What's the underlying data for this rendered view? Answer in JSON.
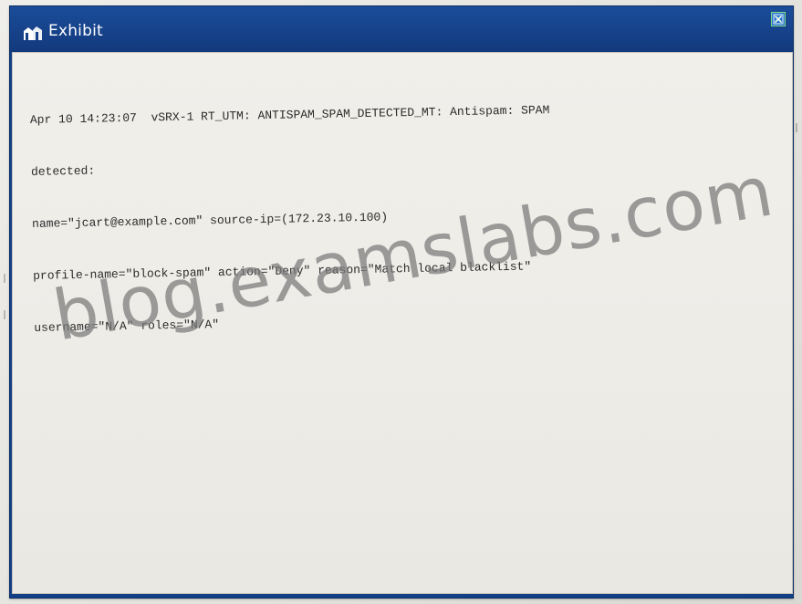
{
  "window": {
    "title": "Exhibit"
  },
  "log": {
    "lines": [
      "Apr 10 14:23:07  vSRX-1 RT_UTM: ANTISPAM_SPAM_DETECTED_MT: Antispam: SPAM",
      "detected:",
      "name=\"jcart@example.com\" source-ip=(172.23.10.100)",
      "profile-name=\"block-spam\" action=\"Deny\" reason=\"Match local blacklist\"",
      "username=\"N/A\" roles=\"N/A\""
    ]
  },
  "watermark": {
    "text": "blog.examslabs.com"
  },
  "colors": {
    "titlebar": "#153f86",
    "content_bg": "#eeece7",
    "close_border": "#7fdc7f"
  },
  "icons": {
    "title_icon": "exhibit-icon",
    "close_icon": "close-icon"
  }
}
